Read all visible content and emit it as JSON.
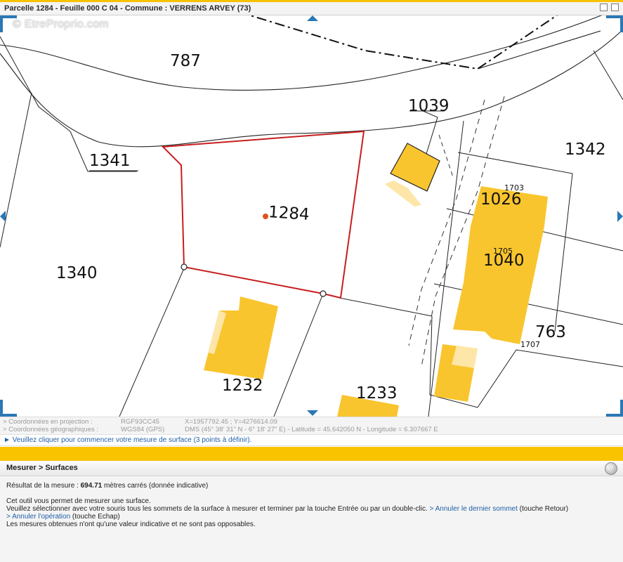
{
  "window": {
    "title": "Parcelle 1284 - Feuille 000 C 04 - Commune : VERRENS ARVEY (73)",
    "buttons": [
      "restore-icon",
      "close-icon"
    ]
  },
  "map": {
    "watermark": "© EtreProprio.com",
    "parcels": {
      "p787": "787",
      "p1039": "1039",
      "p1342": "1342",
      "p1341": "1341",
      "p1284": "1284",
      "p1340": "1340",
      "p1026": "1026",
      "p1040": "1040",
      "p763": "763",
      "p1232": "1232",
      "p1233": "1233"
    },
    "buildings": {
      "b1703": "1703",
      "b1705": "1705",
      "b1707": "1707"
    },
    "colors": {
      "building": "#f9c52e",
      "building_light": "#fde6a8",
      "selected_parcel": "#c81e1e",
      "nav_arrow": "#2a78b5",
      "accent": "#f9c300"
    }
  },
  "coords": {
    "projection_label": "> Coordonnées en projection :",
    "projection_system": "RGF93CC45",
    "projection_value": "X=1957792.45 ; Y=4276614.09",
    "geo_label": "> Coordonnées géographiques :",
    "geo_system": "WGS84 (GPS)",
    "geo_value": "DMS (45° 38' 31\" N - 6° 18' 27\" E) - Latitude = 45.642050 N - Longitude = 6.307667 E"
  },
  "hint": "► Veuillez cliquer pour commencer votre mesure de surface (3 points à définir).",
  "panel": {
    "breadcrumb": "Mesurer > Surfaces",
    "help": "?",
    "result_prefix": "Résultat de la mesure : ",
    "result_value": "694.71",
    "result_suffix": " mètres carrés   (donnée indicative)",
    "line1": "Cet outil vous permet de mesurer une surface.",
    "line2": "Veuillez sélectionner avec votre souris tous les sommets de la surface à mesurer et terminer par la touche Entrée ou par un double-clic. ",
    "undo_link": "> Annuler le dernier sommet",
    "undo_key": " (touche Retour)",
    "cancel_link": "> Annuler l'opération",
    "cancel_key": " (touche Echap)",
    "line4": "Les mesures obtenues n'ont qu'une valeur indicative et ne sont pas opposables."
  }
}
